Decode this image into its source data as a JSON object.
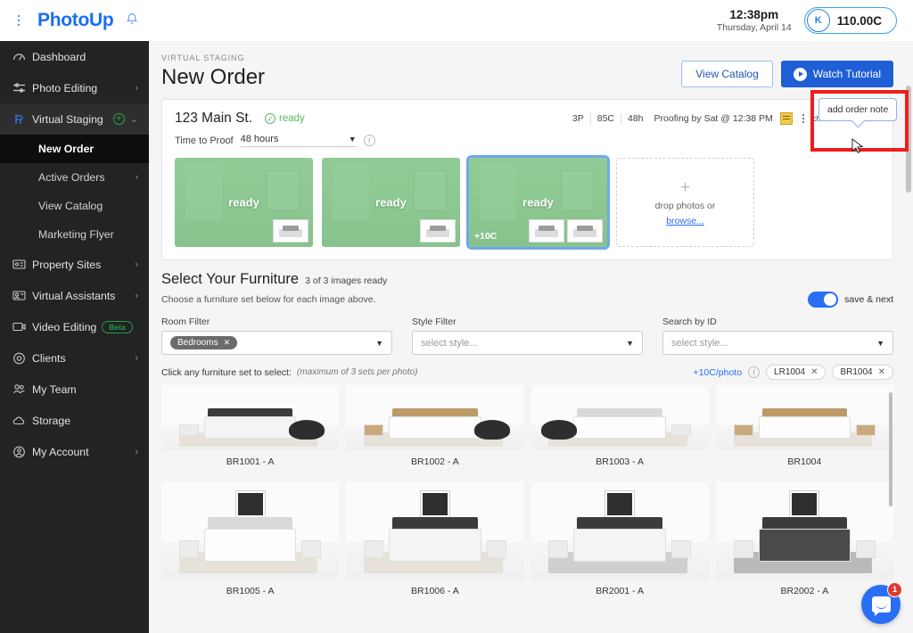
{
  "topbar": {
    "menu_icon": "kebab-menu-icon",
    "brand": "PhotoUp",
    "bell_icon": "bell-icon",
    "time": "12:38pm",
    "date": "Thursday, April 14",
    "credit_initial": "K",
    "credit_balance": "110.00C"
  },
  "sidebar": {
    "items": [
      {
        "label": "Dashboard",
        "icon": "dashboard-icon",
        "chevron": ""
      },
      {
        "label": "Photo Editing",
        "icon": "sliders-icon",
        "chevron": "›"
      },
      {
        "label": "Virtual Staging",
        "icon": "chair-icon",
        "chevron": "⌄",
        "plus": "+"
      },
      {
        "label": "Property Sites",
        "icon": "id-card-icon",
        "chevron": "›"
      },
      {
        "label": "Virtual Assistants",
        "icon": "assistant-icon",
        "chevron": "›"
      },
      {
        "label": "Video Editing",
        "icon": "video-icon",
        "badge": "Beta"
      },
      {
        "label": "Clients",
        "icon": "at-icon",
        "chevron": "›"
      },
      {
        "label": "My Team",
        "icon": "team-icon",
        "chevron": ""
      },
      {
        "label": "Storage",
        "icon": "cloud-icon",
        "chevron": ""
      },
      {
        "label": "My Account",
        "icon": "account-icon",
        "chevron": "›"
      }
    ],
    "sub_items": [
      {
        "label": "New Order",
        "chevron": ""
      },
      {
        "label": "Active Orders",
        "chevron": "›"
      },
      {
        "label": "View Catalog",
        "chevron": ""
      },
      {
        "label": "Marketing Flyer",
        "chevron": ""
      }
    ]
  },
  "page": {
    "eyebrow": "VIRTUAL STAGING",
    "title": "New Order",
    "view_catalog": "View Catalog",
    "watch_tutorial": "Watch Tutorial"
  },
  "order": {
    "address": "123 Main St.",
    "status": "ready",
    "check_glyph": "✓",
    "stats": {
      "photos": "3P",
      "credits": "85C",
      "turnaround": "48h",
      "proofing": "Proofing by Sat @ 12:38 PM"
    },
    "note_icon": "add-note-icon",
    "more_icon": "more-vertical-icon",
    "caret_icon": "chevron-down-icon",
    "time_to_proof_label": "Time to Proof",
    "time_to_proof_value": "48 hours",
    "info_icon": "info-icon",
    "thumbs": [
      {
        "status": "ready",
        "selected": false,
        "minis": 1,
        "price": ""
      },
      {
        "status": "ready",
        "selected": false,
        "minis": 1,
        "price": ""
      },
      {
        "status": "ready",
        "selected": true,
        "minis": 2,
        "price": "+10C"
      }
    ],
    "dropzone": {
      "plus": "+",
      "line1": "drop photos or",
      "line2": "browse..."
    }
  },
  "furniture": {
    "title": "Select Your Furniture",
    "subtitle": "3 of 3 images ready",
    "description": "Choose a furniture set below for each image above.",
    "toggle_label": "save & next",
    "toggle_on": true,
    "filters": [
      {
        "label": "Room Filter",
        "value": "Bedrooms",
        "is_chip": true,
        "chip_x": "✕",
        "placeholder": ""
      },
      {
        "label": "Style Filter",
        "value": "",
        "is_chip": false,
        "placeholder": "select style..."
      },
      {
        "label": "Search by ID",
        "value": "",
        "is_chip": false,
        "placeholder": "select style..."
      }
    ],
    "select_hint": "Click any furniture set to select:",
    "select_note": "(maximum of 3 sets per photo)",
    "price_per_photo": "+10C/photo",
    "info_icon": "info-icon",
    "selected_tags": [
      {
        "id": "LR1004",
        "x": "✕"
      },
      {
        "id": "BR1004",
        "x": "✕"
      }
    ],
    "sets": [
      {
        "id": "BR1001 - A",
        "style": "dark blob"
      },
      {
        "id": "BR1002 - A",
        "style": "wood blob"
      },
      {
        "id": "BR1003 - A",
        "style": "blob"
      },
      {
        "id": "BR1004",
        "style": "wood"
      },
      {
        "id": "BR1005 - A",
        "style": ""
      },
      {
        "id": "BR1006 - A",
        "style": "dark"
      },
      {
        "id": "BR2001 - A",
        "style": "dark"
      },
      {
        "id": "BR2002 - A",
        "style": "dark"
      }
    ]
  },
  "annotation": {
    "tooltip_text": "add order note",
    "highlight_color": "#f01c1c"
  },
  "chat": {
    "icon": "chat-bubble-icon",
    "badge": "1"
  },
  "colors": {
    "brand_blue": "#1a6ef5",
    "primary": "#1f5fd6",
    "ready_green": "#5cb860",
    "sidebar_bg": "#232323"
  }
}
